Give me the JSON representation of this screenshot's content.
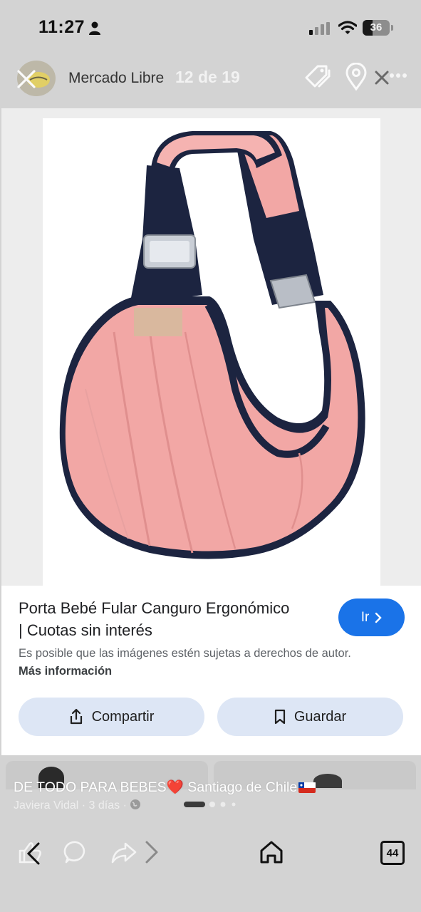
{
  "status_bar": {
    "time": "11:27",
    "battery": "36",
    "battery_level": 0.36
  },
  "header": {
    "site_name": "Mercado Libre",
    "image_counter": "12 de 19"
  },
  "product": {
    "title_line1": "Porta Bebé Fular Canguro Ergonómico",
    "title_line2": "| Cuotas sin interés",
    "go_label": "Ir",
    "copyright_text": "Es posible que las imágenes estén sujetas a derechos de autor.",
    "more_info_label": "Más información",
    "share_label": "Compartir",
    "save_label": "Guardar"
  },
  "feed": {
    "caption_text": "DE TODO PARA BEBES",
    "caption_location": "Santiago de Chile",
    "author": "Javiera Vidal",
    "age": "3 días",
    "separator": "·"
  },
  "bottom_bar": {
    "tabs_count": "44"
  },
  "colors": {
    "accent_blue": "#1a73e8",
    "pill_bg": "#dde6f5",
    "product_pink": "#f2a7a5",
    "product_navy": "#1c2440"
  },
  "icons": [
    "person-icon",
    "signal-icon",
    "wifi-icon",
    "battery-icon",
    "close-icon",
    "tag-icon",
    "location-pin-icon",
    "more-icon",
    "chevron-right-icon",
    "share-icon",
    "bookmark-icon",
    "like-icon",
    "comment-icon",
    "forward-icon",
    "home-icon",
    "tabs-icon"
  ]
}
